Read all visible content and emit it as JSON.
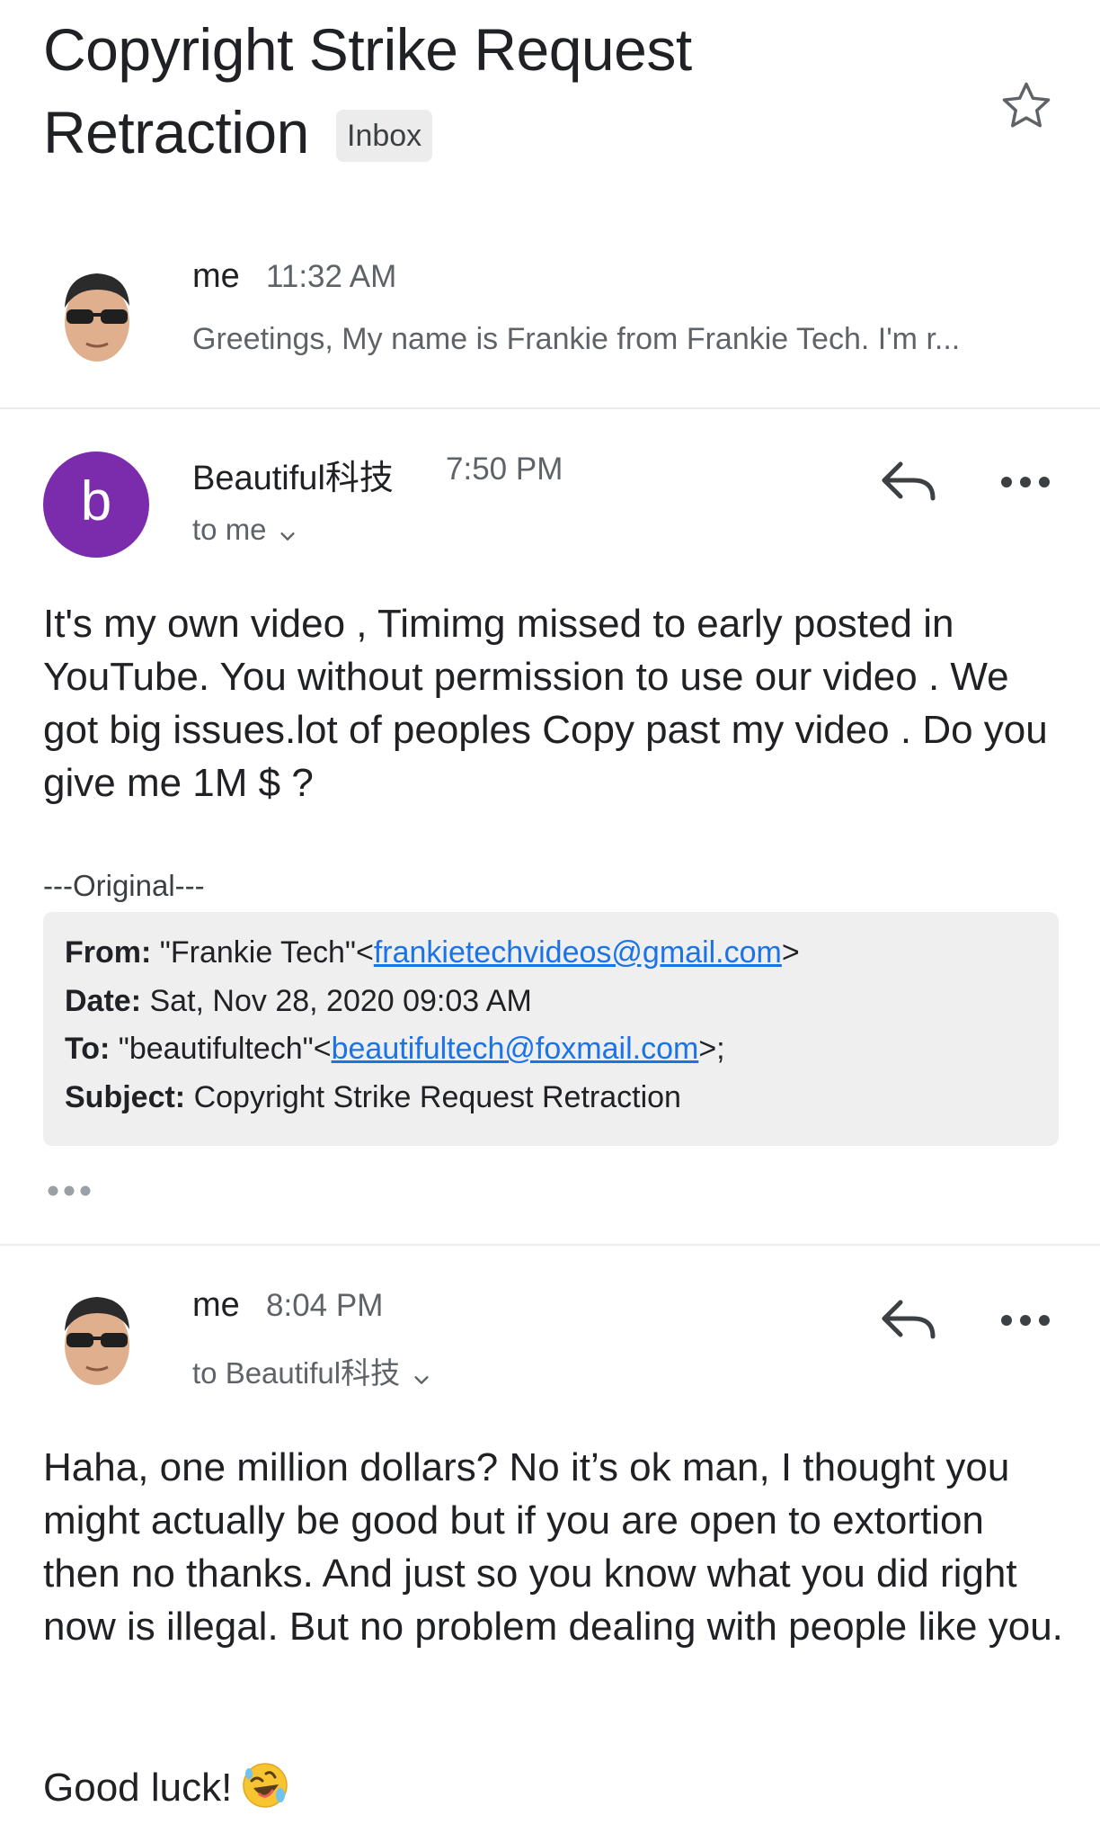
{
  "thread": {
    "subject_line1": "Copyright Strike Request",
    "subject_line2": "Retraction",
    "label": "Inbox"
  },
  "messages": [
    {
      "sender": "me",
      "time": "11:32 AM",
      "snippet": "Greetings, My name is Frankie from Frankie Tech. I'm r...",
      "collapsed": true
    },
    {
      "sender": "Beautiful科技",
      "avatar_letter": "b",
      "avatar_color": "#7b2cad",
      "time": "7:50 PM",
      "recipients": "to me",
      "body": "It's my own video , Timimg missed to early posted in YouTube. You without permission to use our video . We got big issues.lot of peoples Copy past my video . Do you give me 1M $ ?",
      "original_header": "---Original---",
      "quoted": {
        "from_label": "From:",
        "from_name": "\"Frankie Tech\"<",
        "from_email": "frankietechvideos@gmail.com",
        "from_tail": ">",
        "date_label": "Date:",
        "date_value": "Sat, Nov 28, 2020 09:03 AM",
        "to_label": "To:",
        "to_name": "\"beautifultech\"<",
        "to_email": "beautifultech@foxmail.com",
        "to_tail": ">;",
        "subject_label": "Subject:",
        "subject_value": "Copyright Strike Request Retraction"
      }
    },
    {
      "sender": "me",
      "time": "8:04 PM",
      "recipients": "to Beautiful科技",
      "body": "Haha, one million dollars? No it’s ok man, I thought you might actually be good but if you are open to extortion then no thanks. And just so you know what you did right now is illegal. But no problem dealing with people like you.",
      "signoff": "Good luck!",
      "emoji": "rolling-on-floor-laughing"
    }
  ],
  "colors": {
    "link": "#1a73e8",
    "secondary_text": "#5f6368",
    "quote_bg": "#efefef"
  }
}
